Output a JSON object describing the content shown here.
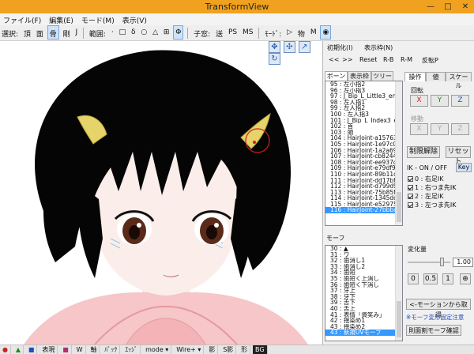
{
  "window": {
    "title": "TransformView",
    "controls": {
      "minimize": "—",
      "maximize": "□",
      "close": "✕"
    }
  },
  "menu": [
    "ファイル(F)",
    "編集(E)",
    "モード(M)",
    "表示(V)"
  ],
  "toolbar": {
    "select_label": "選択:",
    "select_items": [
      "頂",
      "面",
      "骨",
      "剛",
      "J"
    ],
    "selected_item": "骨",
    "range_label": "範囲:",
    "range_items": [
      "·",
      "□",
      "δ",
      "○",
      "△",
      "⊞",
      "Φ"
    ],
    "selected_range": "Φ",
    "child_label": "子窓:",
    "child_items": [
      "送",
      "PS",
      "MS"
    ],
    "mode_label": "ﾓｰﾄﾞ:",
    "mode_items": [
      "▷",
      "物",
      "M"
    ],
    "mode_icon": "◉"
  },
  "viewport": {
    "tool_icons": [
      "✥",
      "✣",
      "↗",
      "↻"
    ]
  },
  "panel": {
    "init_button": "初期化(I)",
    "display_menu": "表示枠(N)",
    "nav_prev": "<<",
    "nav_next": ">>",
    "reset": "Reset",
    "rb": "R-B",
    "rm": "R-M",
    "invert": "反転P",
    "bone_tabs": [
      "ボーン",
      "表示枠",
      "ツリー"
    ],
    "bones": [
      "95 : 左小指2",
      "96 : 左小指3",
      "97 : J_Bip_L_Little3_end",
      "98 : 左人指1",
      "99 : 左人指2",
      "100 : 左人指3",
      "101 : J_Bip_L_Index3_en",
      "102 : 首",
      "103 : 頭",
      "104 : HairJoint-a15763!",
      "105 : HairJoint-1e97c0!",
      "106 : HairJoint-1a2a69!",
      "107 : HairJoint-cb8244!",
      "108 : HairJoint-ee937c!",
      "109 : HairJoint-e79df9e",
      "110 : HairJoint-89b11d!",
      "111 : HairJoint-dd17bf3",
      "112 : HairJoint-d799d9!",
      "113 : HairJoint-75b85f!",
      "114 : HairJoint-1345dd!",
      "115 : HairJoint-e52975!",
      "116 : HairJoint-27bbba"
    ],
    "selected_bone_index": 21,
    "op_tabs": [
      "操作",
      "値",
      "スケール"
    ],
    "rotate_label": "回転",
    "rotate_axes": [
      "X",
      "Y",
      "Z"
    ],
    "move_label": "移動",
    "move_axes": [
      "X",
      "Y",
      "Z"
    ],
    "constraint_release": "制限解除",
    "reset_button": "リセット",
    "ik_label": "IK - ON / OFF",
    "ik_key": "Key",
    "ik_items": [
      "0 : 右足IK",
      "1 : 右つま先IK",
      "2 : 左足IK",
      "3 : 左つま先IK"
    ],
    "morph_label": "モーフ",
    "morphs": [
      "30 : ▲",
      "31 : ワ",
      "32 : 歯消し1",
      "33 : 歯消し2",
      "34 : 歯短",
      "35 : 歯短く上消し",
      "36 : 歯短く下消し",
      "37 : 牙上",
      "38 : 牙下",
      "39 : 舌下",
      "40 : 舌上",
      "41 : 表情「資笑み」",
      "42 : 揺染め1",
      "43 : 揺染め2",
      "43 : 新規UVモーフ"
    ],
    "selected_morph_index": 14,
    "morph_value_label": "変化量",
    "morph_value": "1.00",
    "morph_slider_level": 0.8,
    "preset_0": "0",
    "preset_05": "0.5",
    "preset_1": "1",
    "preset_icon": "⊕",
    "get_motion": "<-モーションから取得",
    "notice": "※モーフ変形固定注意",
    "confirm_button": "則面割モーフ確認"
  },
  "statusbar": {
    "items": [
      "●",
      "▲",
      "■",
      "表現",
      "■",
      "W",
      "軸",
      "ﾊﾞｯｸ",
      "ｴｯｼﾞ",
      "mode ▾",
      "Wire+ ▾",
      "影",
      "S影",
      "形",
      "BG"
    ]
  },
  "colors": {
    "titlebar": "#f0a11f",
    "selection": "#3399ff",
    "axis_x": "#d22020",
    "axis_y": "#1e8a1e",
    "axis_z": "#1f4fbf",
    "notice": "#1f4fbf"
  }
}
